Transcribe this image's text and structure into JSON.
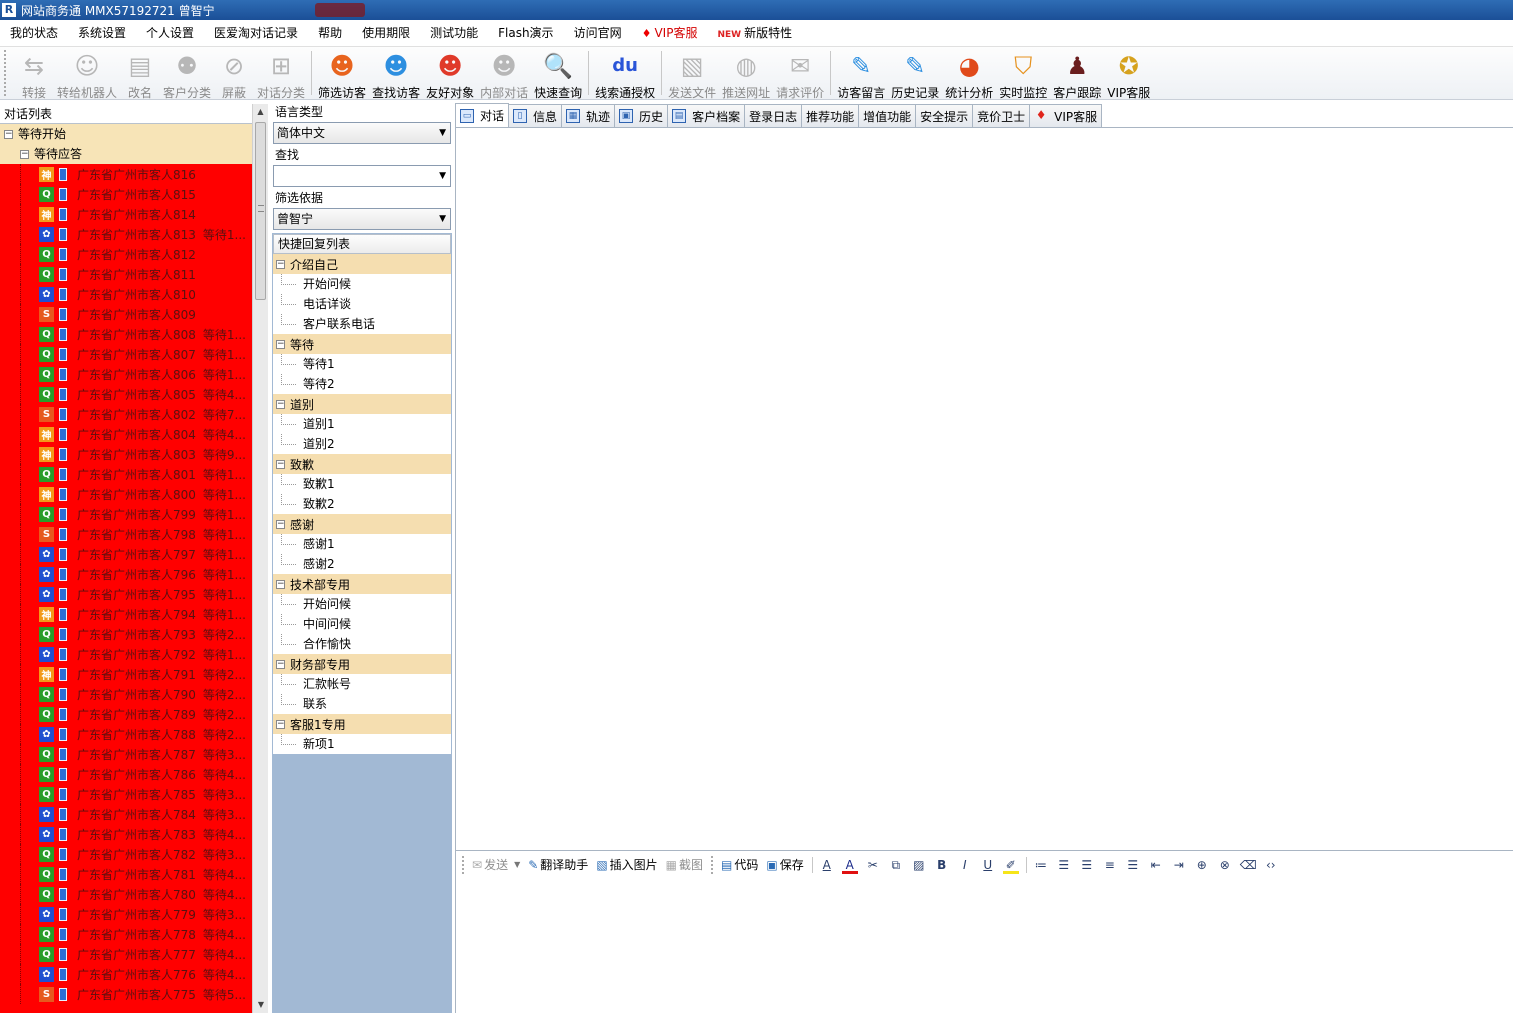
{
  "titlebar": {
    "app_icon": "R",
    "title": "网站商务通  MMX57192721 曾智宁"
  },
  "menu": [
    {
      "label": "我的状态",
      "cls": ""
    },
    {
      "label": "系统设置",
      "cls": ""
    },
    {
      "label": "个人设置",
      "cls": ""
    },
    {
      "label": "医爱淘对话记录",
      "cls": ""
    },
    {
      "label": "帮助",
      "cls": ""
    },
    {
      "label": "使用期限",
      "cls": ""
    },
    {
      "label": "测试功能",
      "cls": ""
    },
    {
      "label": "Flash演示",
      "cls": ""
    },
    {
      "label": "访问官网",
      "cls": ""
    },
    {
      "label": "VIP客服",
      "cls": "vip",
      "icon": "diamond-icon",
      "glyph": "♦"
    },
    {
      "label": "新版特性",
      "cls": "newf",
      "icon": "new-badge-icon",
      "glyph": "NEW"
    }
  ],
  "toolbar": [
    {
      "label": "转接",
      "icon": "transfer-icon",
      "glyph": "⇆",
      "disabled": true
    },
    {
      "label": "转给机器人",
      "icon": "robot-icon",
      "glyph": "☺",
      "disabled": true
    },
    {
      "label": "改名",
      "icon": "rename-icon",
      "glyph": "▤",
      "disabled": true
    },
    {
      "label": "客户分类",
      "icon": "customer-category-icon",
      "glyph": "⚉",
      "disabled": true
    },
    {
      "label": "屏蔽",
      "icon": "block-icon",
      "glyph": "⊘",
      "disabled": true
    },
    {
      "label": "对话分类",
      "icon": "dialog-category-icon",
      "glyph": "⊞",
      "disabled": true
    },
    {
      "sep": true
    },
    {
      "label": "筛选访客",
      "icon": "filter-visitor-icon",
      "glyph": "☻",
      "color": "#e8641e"
    },
    {
      "label": "查找访客",
      "icon": "find-visitor-icon",
      "glyph": "☻",
      "color": "#2d8fe0"
    },
    {
      "label": "友好对象",
      "icon": "friend-icon",
      "glyph": "☻",
      "color": "#e03a2a"
    },
    {
      "label": "内部对话",
      "icon": "internal-dialog-icon",
      "glyph": "☻",
      "disabled": true
    },
    {
      "label": "快速查询",
      "icon": "quick-search-icon",
      "glyph": "🔍",
      "color": "#4a7ab8"
    },
    {
      "sep": true
    },
    {
      "label": "线索通授权",
      "icon": "baidu-icon",
      "glyph": "du",
      "color": "#2a55d8"
    },
    {
      "sep": true
    },
    {
      "label": "发送文件",
      "icon": "send-file-icon",
      "glyph": "▧",
      "disabled": true
    },
    {
      "label": "推送网址",
      "icon": "push-url-icon",
      "glyph": "◍",
      "disabled": true
    },
    {
      "label": "请求评价",
      "icon": "request-rating-icon",
      "glyph": "✉",
      "disabled": true
    },
    {
      "sep": true
    },
    {
      "label": "访客留言",
      "icon": "visitor-message-icon",
      "glyph": "✎",
      "color": "#2d8fe0"
    },
    {
      "label": "历史记录",
      "icon": "history-icon",
      "glyph": "✎",
      "color": "#2d8fe0"
    },
    {
      "label": "统计分析",
      "icon": "statistics-icon",
      "glyph": "◕",
      "color": "#e04a1a"
    },
    {
      "label": "实时监控",
      "icon": "monitor-shield-icon",
      "glyph": "⛉",
      "color": "#e6921e"
    },
    {
      "label": "客户跟踪",
      "icon": "customer-tracking-icon",
      "glyph": "♟",
      "color": "#6a1e1e"
    },
    {
      "label": "VIP客服",
      "icon": "vip-medal-icon",
      "glyph": "✪",
      "color": "#d6a21e"
    }
  ],
  "left": {
    "header": "对话列表",
    "group_wait_start": "等待开始",
    "group_wait_reply": "等待应答",
    "visitors": [
      {
        "name": "广东省广州市客人816",
        "wait": "",
        "src": "orange"
      },
      {
        "name": "广东省广州市客人815",
        "wait": "",
        "src": "green"
      },
      {
        "name": "广东省广州市客人814",
        "wait": "",
        "src": "orange"
      },
      {
        "name": "广东省广州市客人813",
        "wait": "等待1...",
        "src": "blue"
      },
      {
        "name": "广东省广州市客人812",
        "wait": "",
        "src": "green"
      },
      {
        "name": "广东省广州市客人811",
        "wait": "",
        "src": "green"
      },
      {
        "name": "广东省广州市客人810",
        "wait": "",
        "src": "blue"
      },
      {
        "name": "广东省广州市客人809",
        "wait": "",
        "src": "sogou"
      },
      {
        "name": "广东省广州市客人808",
        "wait": "等待1...",
        "src": "green"
      },
      {
        "name": "广东省广州市客人807",
        "wait": "等待1...",
        "src": "green"
      },
      {
        "name": "广东省广州市客人806",
        "wait": "等待1...",
        "src": "green"
      },
      {
        "name": "广东省广州市客人805",
        "wait": "等待4...",
        "src": "green"
      },
      {
        "name": "广东省广州市客人802",
        "wait": "等待7...",
        "src": "sogou"
      },
      {
        "name": "广东省广州市客人804",
        "wait": "等待4...",
        "src": "orange"
      },
      {
        "name": "广东省广州市客人803",
        "wait": "等待9...",
        "src": "orange"
      },
      {
        "name": "广东省广州市客人801",
        "wait": "等待1...",
        "src": "green"
      },
      {
        "name": "广东省广州市客人800",
        "wait": "等待1...",
        "src": "orange"
      },
      {
        "name": "广东省广州市客人799",
        "wait": "等待1...",
        "src": "green"
      },
      {
        "name": "广东省广州市客人798",
        "wait": "等待1...",
        "src": "sogou"
      },
      {
        "name": "广东省广州市客人797",
        "wait": "等待1...",
        "src": "blue"
      },
      {
        "name": "广东省广州市客人796",
        "wait": "等待1...",
        "src": "blue"
      },
      {
        "name": "广东省广州市客人795",
        "wait": "等待1...",
        "src": "blue"
      },
      {
        "name": "广东省广州市客人794",
        "wait": "等待1...",
        "src": "orange"
      },
      {
        "name": "广东省广州市客人793",
        "wait": "等待2...",
        "src": "green"
      },
      {
        "name": "广东省广州市客人792",
        "wait": "等待1...",
        "src": "blue"
      },
      {
        "name": "广东省广州市客人791",
        "wait": "等待2...",
        "src": "orange"
      },
      {
        "name": "广东省广州市客人790",
        "wait": "等待2...",
        "src": "green"
      },
      {
        "name": "广东省广州市客人789",
        "wait": "等待2...",
        "src": "green"
      },
      {
        "name": "广东省广州市客人788",
        "wait": "等待2...",
        "src": "blue"
      },
      {
        "name": "广东省广州市客人787",
        "wait": "等待3...",
        "src": "green"
      },
      {
        "name": "广东省广州市客人786",
        "wait": "等待4...",
        "src": "green"
      },
      {
        "name": "广东省广州市客人785",
        "wait": "等待3...",
        "src": "green"
      },
      {
        "name": "广东省广州市客人784",
        "wait": "等待3...",
        "src": "blue"
      },
      {
        "name": "广东省广州市客人783",
        "wait": "等待4...",
        "src": "blue"
      },
      {
        "name": "广东省广州市客人782",
        "wait": "等待3...",
        "src": "green"
      },
      {
        "name": "广东省广州市客人781",
        "wait": "等待4...",
        "src": "green"
      },
      {
        "name": "广东省广州市客人780",
        "wait": "等待4...",
        "src": "green"
      },
      {
        "name": "广东省广州市客人779",
        "wait": "等待3...",
        "src": "blue"
      },
      {
        "name": "广东省广州市客人778",
        "wait": "等待4...",
        "src": "green"
      },
      {
        "name": "广东省广州市客人777",
        "wait": "等待4...",
        "src": "green"
      },
      {
        "name": "广东省广州市客人776",
        "wait": "等待4...",
        "src": "blue"
      },
      {
        "name": "广东省广州市客人775",
        "wait": "等待5...",
        "src": "sogou"
      }
    ]
  },
  "mid": {
    "lang_label": "语言类型",
    "lang_value": "简体中文",
    "search_label": "查找",
    "search_value": "",
    "filter_label": "筛选依据",
    "filter_value": "曾智宁",
    "qr_header": "快捷回复列表",
    "groups": [
      {
        "title": "介绍自己",
        "items": [
          "开始问候",
          "电话详谈",
          "客户联系电话"
        ]
      },
      {
        "title": "等待",
        "items": [
          "等待1",
          "等待2"
        ]
      },
      {
        "title": "道别",
        "items": [
          "道别1",
          "道别2"
        ]
      },
      {
        "title": "致歉",
        "items": [
          "致歉1",
          "致歉2"
        ]
      },
      {
        "title": "感谢",
        "items": [
          "感谢1",
          "感谢2"
        ]
      },
      {
        "title": "技术部专用",
        "items": [
          "开始问候",
          "中间问候",
          "合作愉快"
        ]
      },
      {
        "title": "财务部专用",
        "items": [
          "汇款帐号",
          "联系"
        ]
      },
      {
        "title": "客服1专用",
        "items": [
          "新项1"
        ]
      }
    ]
  },
  "tabs": [
    {
      "label": "对话",
      "icon": "dialog-icon",
      "glyph": "▭",
      "active": true
    },
    {
      "label": "信息",
      "icon": "info-icon",
      "glyph": "▯"
    },
    {
      "label": "轨迹",
      "icon": "track-icon",
      "glyph": "▦"
    },
    {
      "label": "历史",
      "icon": "history-tab-icon",
      "glyph": "▣"
    },
    {
      "label": "客户档案",
      "icon": "customer-file-icon",
      "glyph": "▤"
    },
    {
      "label": "登录日志"
    },
    {
      "label": "推荐功能"
    },
    {
      "label": "增值功能"
    },
    {
      "label": "安全提示"
    },
    {
      "label": "竞价卫士"
    },
    {
      "label": "VIP客服",
      "icon": "vip-tab-icon",
      "glyph": "♦",
      "red": true
    }
  ],
  "editor": {
    "buttons": [
      {
        "label": "发送",
        "icon": "send-icon",
        "glyph": "✉",
        "disabled": true,
        "dropdown": true
      },
      {
        "label": "翻译助手",
        "icon": "translate-icon",
        "glyph": "✎"
      },
      {
        "label": "插入图片",
        "icon": "insert-image-icon",
        "glyph": "▧"
      },
      {
        "label": "截图",
        "icon": "screenshot-icon",
        "glyph": "▦",
        "disabled": true
      }
    ],
    "buttons2": [
      {
        "label": "代码",
        "icon": "code-icon",
        "glyph": "▤"
      },
      {
        "label": "保存",
        "icon": "save-icon",
        "glyph": "▣"
      }
    ],
    "format": [
      {
        "name": "font-icon",
        "glyph": "A"
      },
      {
        "name": "font-color-icon",
        "glyph": "A"
      },
      {
        "name": "cut-icon",
        "glyph": "✂"
      },
      {
        "name": "copy-icon",
        "glyph": "⧉"
      },
      {
        "name": "paste-icon",
        "glyph": "▨"
      },
      {
        "name": "bold-icon",
        "glyph": "B"
      },
      {
        "name": "italic-icon",
        "glyph": "I"
      },
      {
        "name": "underline-icon",
        "glyph": "U"
      },
      {
        "name": "highlight-icon",
        "glyph": "✐"
      },
      {
        "sep": true
      },
      {
        "name": "ordered-list-icon",
        "glyph": "≔"
      },
      {
        "name": "unordered-list-icon",
        "glyph": "☰"
      },
      {
        "name": "align-left-icon",
        "glyph": "☰"
      },
      {
        "name": "align-center-icon",
        "glyph": "≡"
      },
      {
        "name": "align-right-icon",
        "glyph": "☰"
      },
      {
        "name": "outdent-icon",
        "glyph": "⇤"
      },
      {
        "name": "indent-icon",
        "glyph": "⇥"
      },
      {
        "name": "insert-link-icon",
        "glyph": "⊕"
      },
      {
        "name": "unlink-icon",
        "glyph": "⊗"
      },
      {
        "name": "eraser-icon",
        "glyph": "⌫"
      },
      {
        "name": "source-icon",
        "glyph": "‹›"
      }
    ]
  },
  "colors": {
    "list_bg": "#ff0000",
    "group_bg": "#f7e4b7",
    "mid_bg": "#a2b9d4",
    "titlebar": "#1b4f97"
  }
}
